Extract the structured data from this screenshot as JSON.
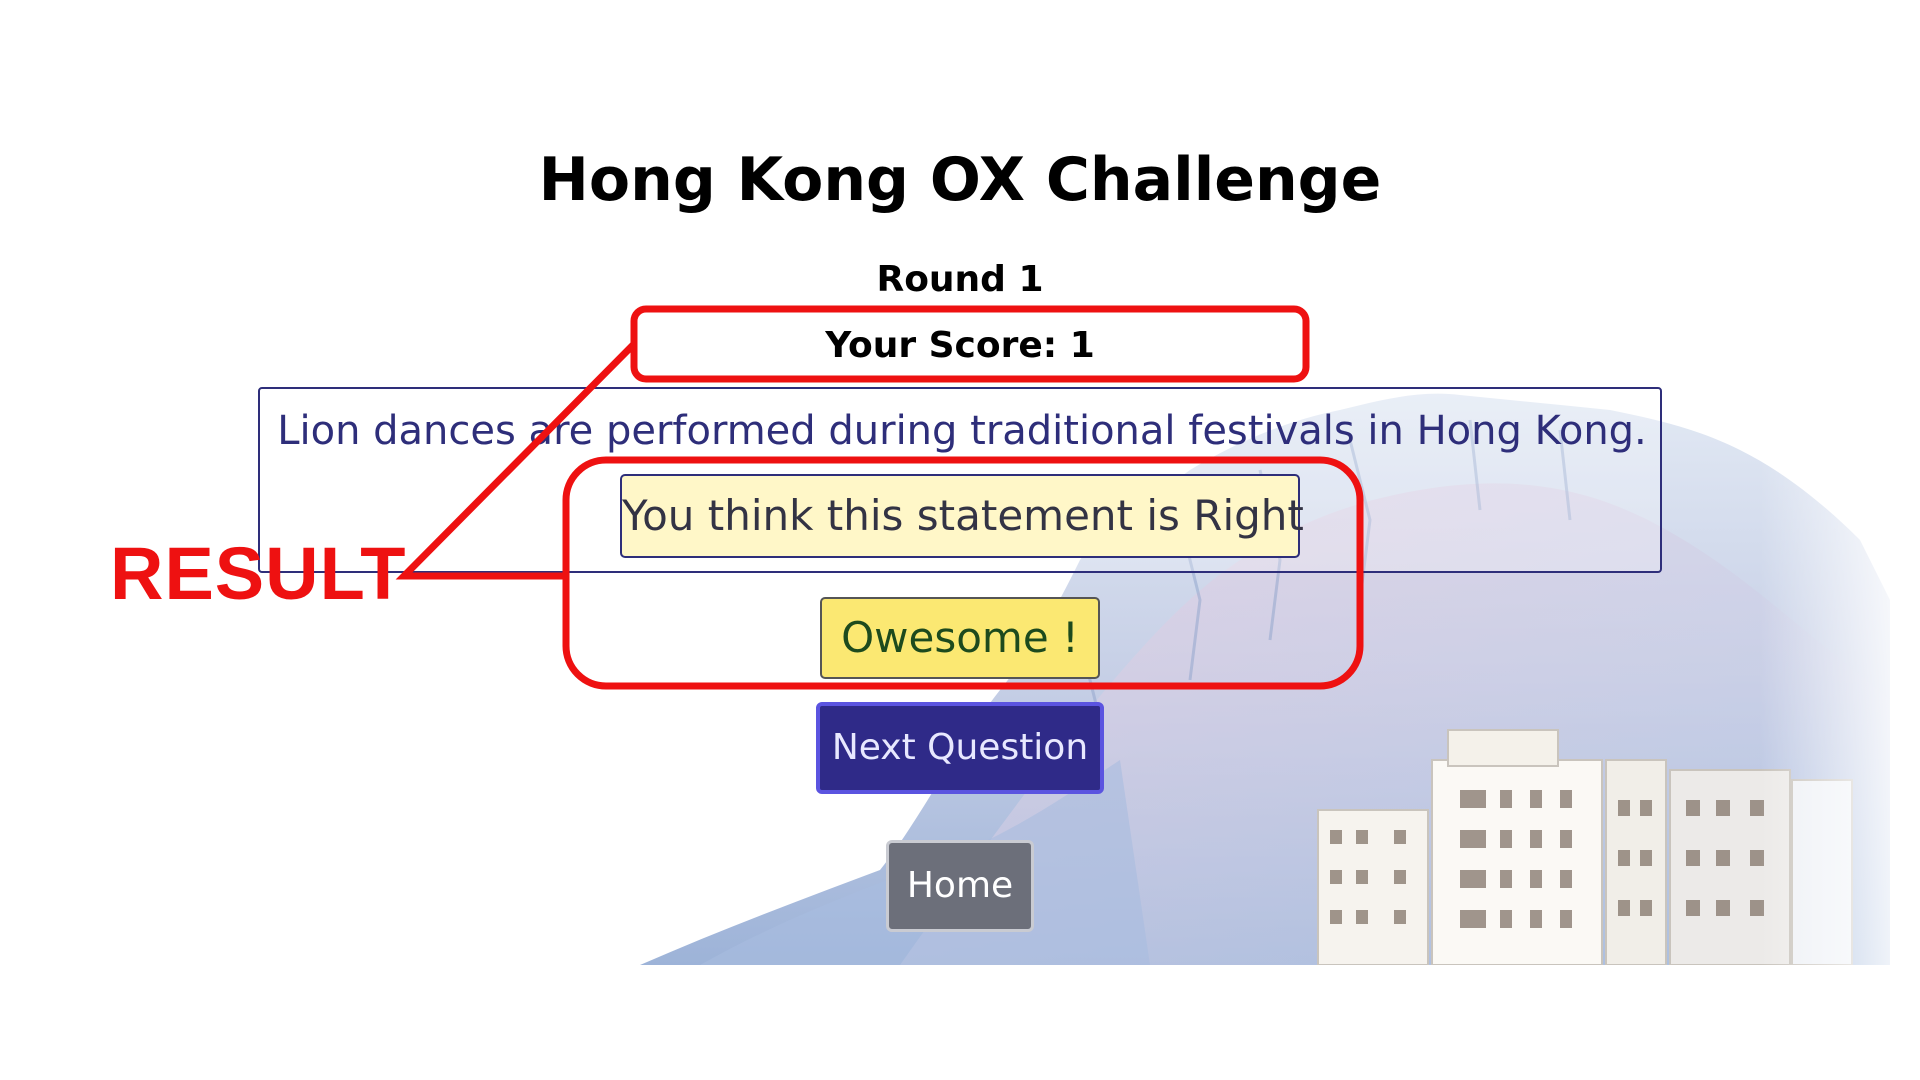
{
  "app": {
    "title": "Hong Kong OX Challenge"
  },
  "game": {
    "round_label": "Round 1",
    "score_label": "Your Score: 1",
    "question": "Lion dances are performed during traditional festivals in Hong Kong.",
    "answer_feedback": "You think this statement is Right",
    "result_message": "Owesome !"
  },
  "buttons": {
    "next_label": "Next Question",
    "home_label": "Home"
  },
  "annotation": {
    "label": "RESULT",
    "color": "#ee1111"
  },
  "colors": {
    "question_text": "#2e2e7a",
    "answer_bg": "#fff7c8",
    "feedback_bg": "#fbe872",
    "next_button_bg": "#2f2a88",
    "home_button_bg": "#6c6f7a"
  }
}
